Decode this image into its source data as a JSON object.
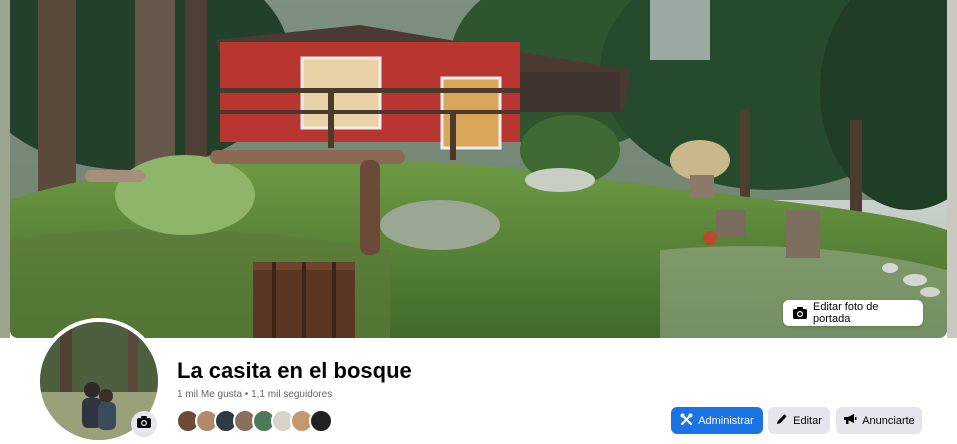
{
  "cover": {
    "edit_button_label": "Editar foto de portada",
    "edit_button_icon": "camera-icon"
  },
  "page": {
    "title": "La casita en el bosque",
    "stats": "1 mil Me gusta • 1,1 mil seguidores"
  },
  "profile": {
    "camera_icon": "camera-icon"
  },
  "friends": {
    "count_shown": 8,
    "colors": [
      "#6b4a3a",
      "#b08a6a",
      "#2f3a44",
      "#8a6f5a",
      "#4d7a5a",
      "#d8d4c8",
      "#c49a6c",
      "#222222"
    ]
  },
  "actions": {
    "admin_label": "Administrar",
    "admin_icon": "tools-icon",
    "edit_label": "Editar",
    "edit_icon": "pencil-icon",
    "advertise_label": "Anunciarte",
    "advertise_icon": "megaphone-icon"
  },
  "colors": {
    "primary": "#1b74e4",
    "secondary_button": "#e4e6eb",
    "text": "#050505",
    "muted": "#65676b"
  }
}
